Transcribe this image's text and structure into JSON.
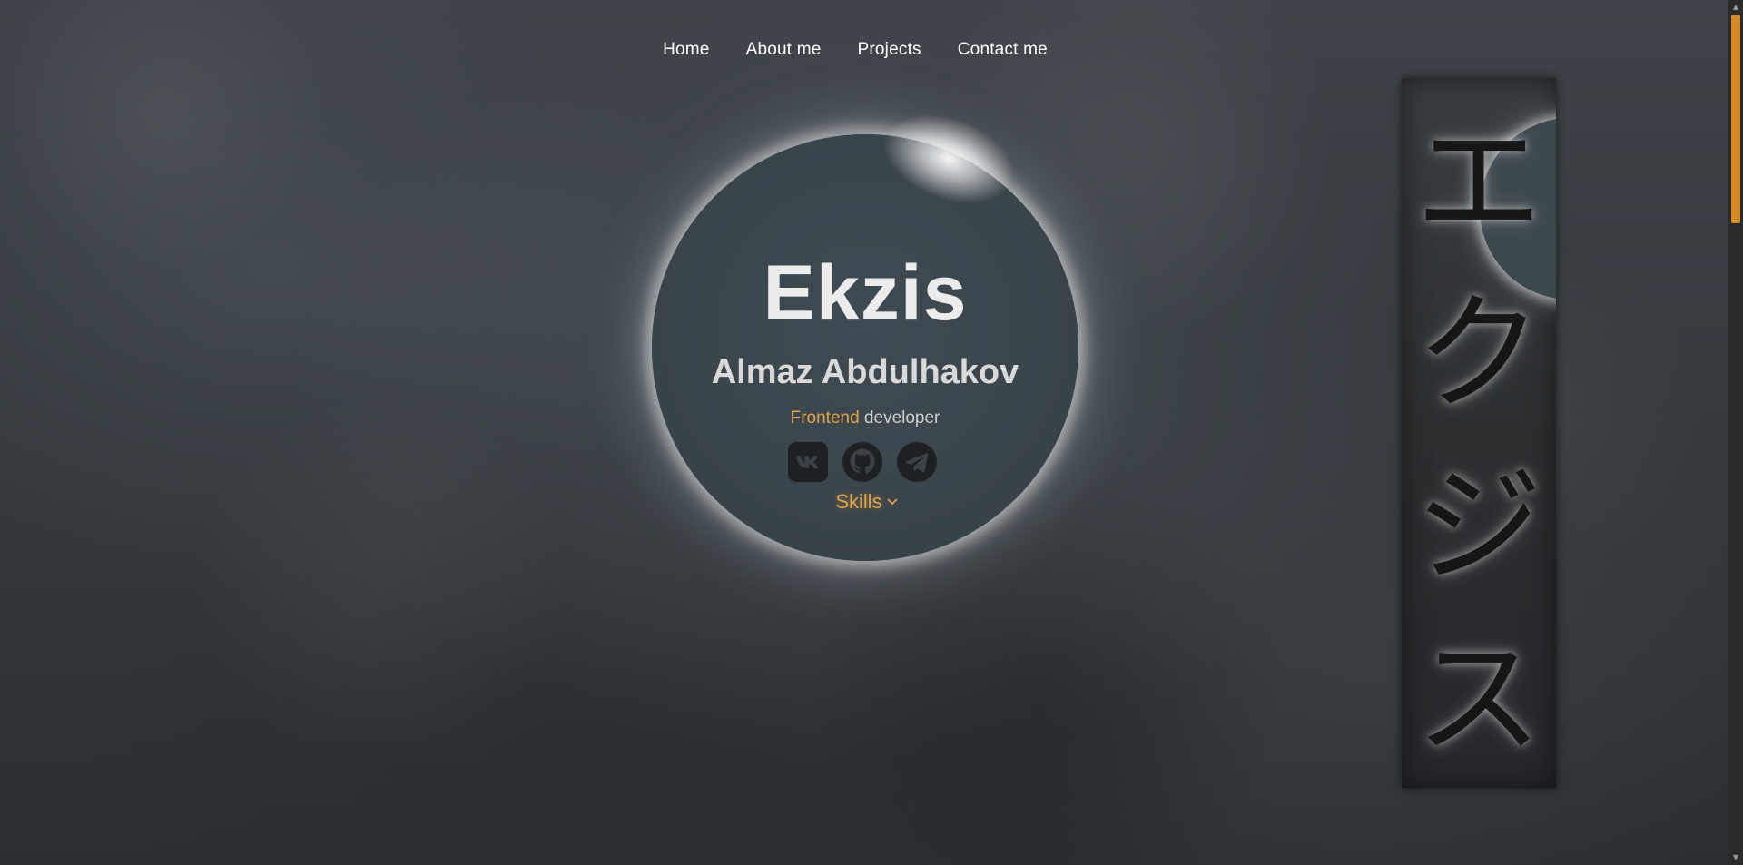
{
  "nav": {
    "items": [
      {
        "label": "Home"
      },
      {
        "label": "About me"
      },
      {
        "label": "Projects"
      },
      {
        "label": "Contact me"
      }
    ]
  },
  "hero": {
    "title": "Ekzis",
    "name": "Almaz Abdulhakov",
    "role_accent": "Frontend",
    "role_rest": " developer",
    "skills_label": "Skills"
  },
  "socials": [
    {
      "icon": "vk-icon"
    },
    {
      "icon": "github-icon"
    },
    {
      "icon": "telegram-icon"
    }
  ],
  "banner": {
    "kanji": [
      "エ",
      "ク",
      "ジ",
      "ス"
    ]
  },
  "colors": {
    "accent": "#e0a24a",
    "scroll_thumb": "#d58a24",
    "text": "#ffffff"
  }
}
